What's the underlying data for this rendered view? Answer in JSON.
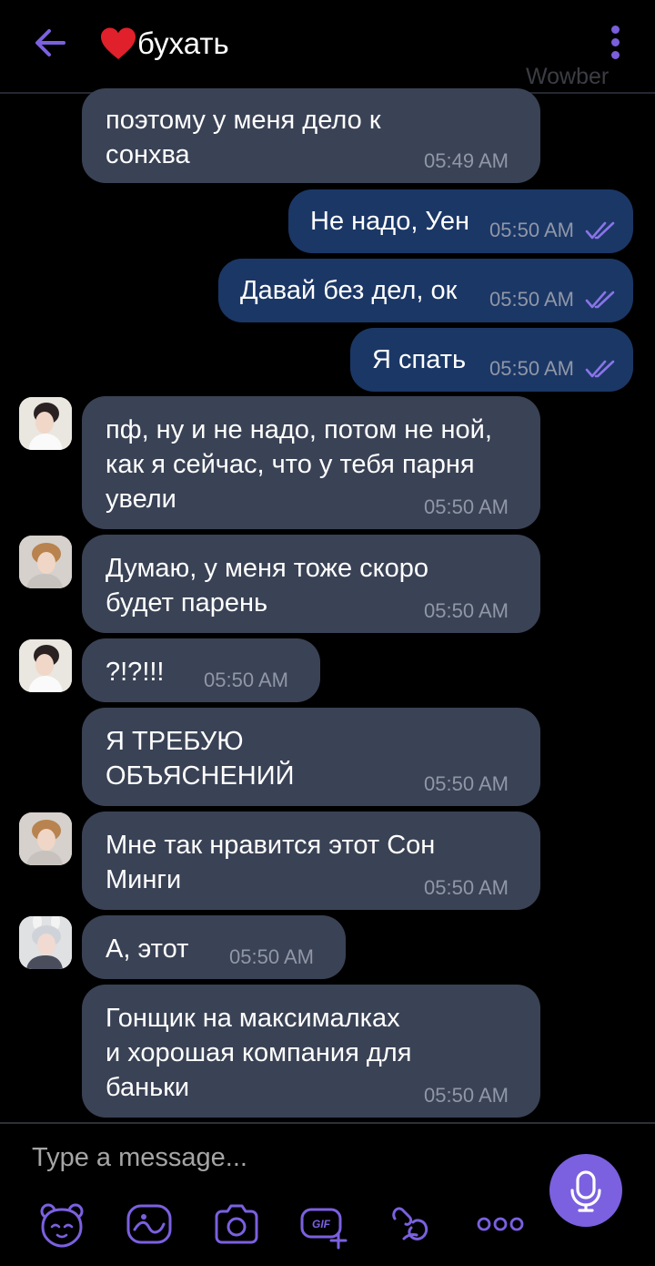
{
  "header": {
    "title": "бухать",
    "watermark": "Wowber"
  },
  "messages": [
    {
      "text": "поэтому у меня дело к\nсонхва",
      "time": "05:49 AM"
    },
    {
      "text": "Не надо, Уен",
      "time": "05:50 AM"
    },
    {
      "text": "Давай без дел, ок",
      "time": "05:50 AM"
    },
    {
      "text": "Я спать",
      "time": "05:50 AM"
    },
    {
      "text": "пф, ну и не надо, потом не ной,\nкак я сейчас, что у тебя парня\nувели",
      "time": "05:50 AM"
    },
    {
      "text": "Думаю, у меня тоже скоро\nбудет парень",
      "time": "05:50 AM"
    },
    {
      "text": "?!?!!!",
      "time": "05:50 AM"
    },
    {
      "text": "Я ТРЕБУЮ\nОБЪЯСНЕНИЙ",
      "time": "05:50 AM"
    },
    {
      "text": "Мне так нравится этот Сон\nМинги",
      "time": "05:50 AM"
    },
    {
      "text": "А, этот",
      "time": "05:50 AM"
    },
    {
      "text": "Гонщик на максималках\nи хорошая компания для\nбаньки",
      "time": "05:50 AM"
    }
  ],
  "composer": {
    "placeholder": "Type a message...",
    "icons": [
      "sticker-icon",
      "doodle-icon",
      "camera-icon",
      "gif-icon",
      "link-icon",
      "more-options-icon"
    ]
  },
  "colors": {
    "accent": "#7b60e0",
    "incoming": "#3a4255",
    "outgoing": "#1b3766",
    "background": "#000000"
  }
}
